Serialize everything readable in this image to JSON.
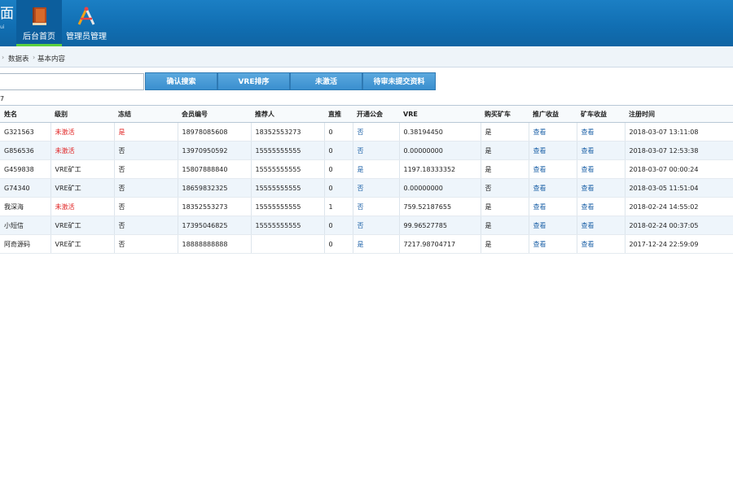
{
  "header": {
    "brand_big": "面",
    "brand_small": "ui",
    "nav": [
      {
        "label": "后台首页",
        "icon": "book-icon"
      },
      {
        "label": "管理员管理",
        "icon": "tools-icon"
      }
    ]
  },
  "breadcrumb": {
    "items": [
      "数据表",
      "基本内容"
    ]
  },
  "search": {
    "value": "",
    "placeholder": ""
  },
  "buttons": [
    "确认搜索",
    "VRE排序",
    "未激活",
    "待审未提交资料"
  ],
  "record_count": "7",
  "table": {
    "headers": [
      "姓名",
      "级别",
      "冻结",
      "会员编号",
      "推荐人",
      "直推",
      "开通公会",
      "VRE",
      "购买矿车",
      "推广收益",
      "矿车收益",
      "注册时间"
    ],
    "rows": [
      [
        "G321563",
        "未激活",
        "是",
        "18978085608",
        "18352553273",
        "0",
        "否",
        "0.38194450",
        "是",
        "查看",
        "查看",
        "2018-03-07 13:11:08"
      ],
      [
        "G856536",
        "未激活",
        "否",
        "13970950592",
        "15555555555",
        "0",
        "否",
        "0.00000000",
        "是",
        "查看",
        "查看",
        "2018-03-07 12:53:38"
      ],
      [
        "G459838",
        "VRE矿工",
        "否",
        "15807888840",
        "15555555555",
        "0",
        "是",
        "1197.18333352",
        "是",
        "查看",
        "查看",
        "2018-03-07 00:00:24"
      ],
      [
        "G74340",
        "VRE矿工",
        "否",
        "18659832325",
        "15555555555",
        "0",
        "否",
        "0.00000000",
        "否",
        "查看",
        "查看",
        "2018-03-05 11:51:04"
      ],
      [
        "我深海",
        "未激活",
        "否",
        "18352553273",
        "15555555555",
        "1",
        "否",
        "759.52187655",
        "是",
        "查看",
        "查看",
        "2018-02-24 14:55:02"
      ],
      [
        "小短信",
        "VRE矿工",
        "否",
        "17395046825",
        "15555555555",
        "0",
        "否",
        "99.96527785",
        "是",
        "查看",
        "查看",
        "2018-02-24 00:37:05"
      ],
      [
        "阿奇源码",
        "VRE矿工",
        "否",
        "18888888888",
        "",
        "0",
        "是",
        "7217.98704717",
        "是",
        "查看",
        "查看",
        "2017-12-24 22:59:09"
      ]
    ]
  },
  "colors": {
    "header_blue": "#1473b8",
    "inactive_red": "#e02020",
    "link_blue": "#1f63a8",
    "active_tab_green": "#5bcf3e"
  }
}
